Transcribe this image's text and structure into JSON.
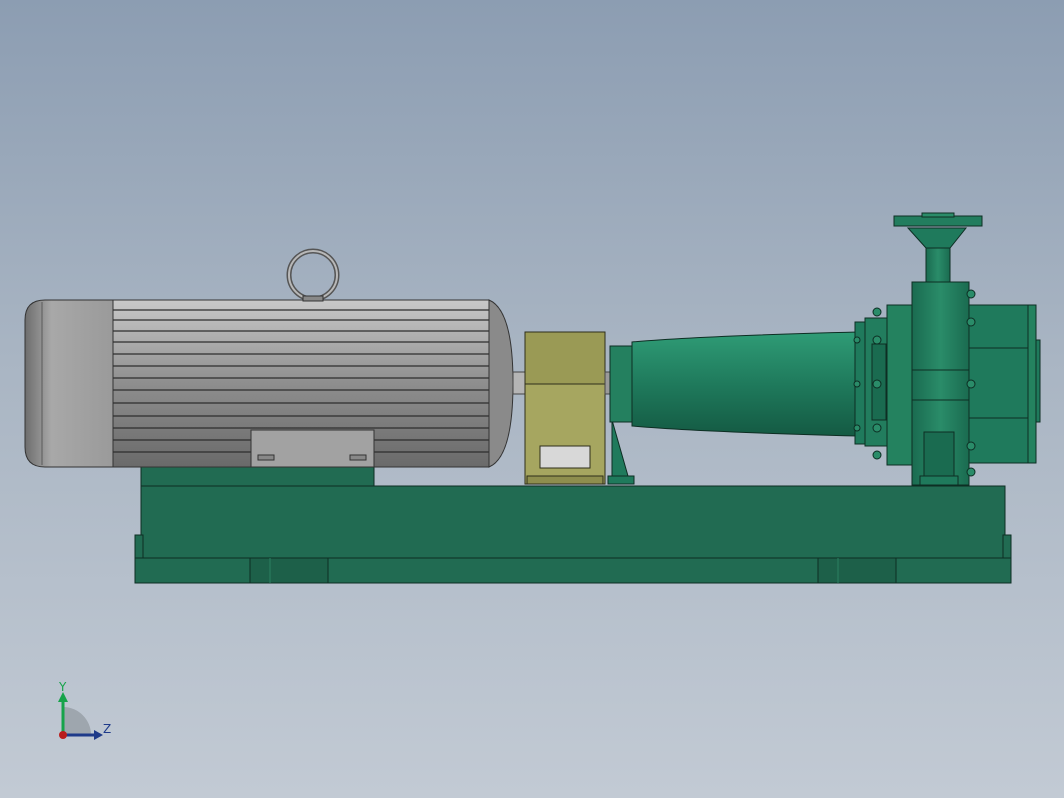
{
  "viewport": {
    "background_top": "#8c9db2",
    "background_bottom": "#c2cad4"
  },
  "model": {
    "motor_color": "#9a9a9a",
    "bracket_color": "#9a9a55",
    "pump_color": "#1f7a5c",
    "base_color": "#216b52"
  },
  "triad": {
    "y_label": "Y",
    "z_label": "Z",
    "y_color": "#16a34a",
    "z_color": "#1e3a8a",
    "x_color": "#b91c1c"
  },
  "icons": [
    "lifting-eye-icon",
    "coordinate-triad-icon"
  ]
}
